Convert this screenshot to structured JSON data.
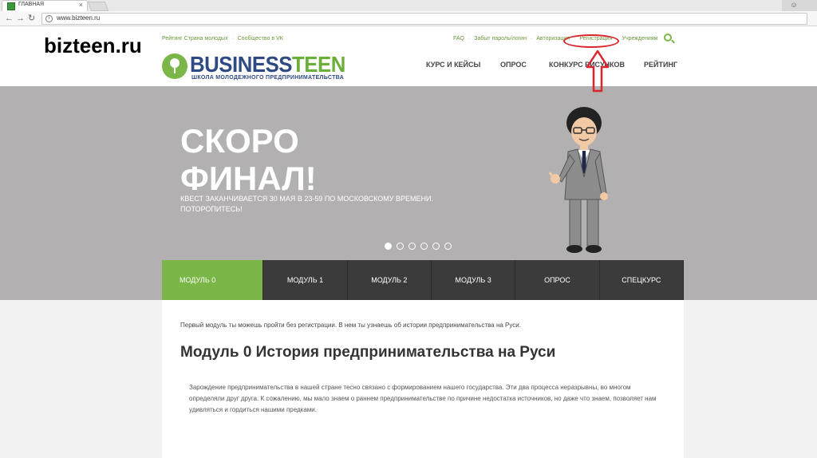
{
  "browser": {
    "tab_title": "ГЛАВНАЯ",
    "tab_close": "×",
    "url": "www.bizteen.ru"
  },
  "watermark": "bizteen.ru",
  "header": {
    "top_left_links": [
      "Рейтинг Страна молодых",
      "Сообщество в VK"
    ],
    "top_right_links": [
      "FAQ",
      "Забыт пароль/логин",
      "Авторизация",
      "Регистрация",
      "Учреждениям"
    ],
    "separator": "·",
    "logo_main": "BUSINESS",
    "logo_accent": "TEEN",
    "logo_subtitle": "ШКОЛА МОЛОДЕЖНОГО ПРЕДПРИНИМАТЕЛЬСТВА",
    "nav": [
      "КУРС И КЕЙСЫ",
      "ОПРОС",
      "КОНКУРС РИСУНКОВ",
      "РЕЙТИНГ"
    ]
  },
  "hero": {
    "title_line1": "СКОРО",
    "title_line2": "ФИНАЛ!",
    "subtitle": "КВЕСТ ЗАКАНЧИВАЕТСЯ 30 МАЯ В 23-59 ПО МОСКОВСКОМУ ВРЕМЕНИ. ПОТОРОПИТЕСЬ!",
    "slide_count": 6,
    "active_slide": 1
  },
  "modules": {
    "tabs": [
      "МОДУЛЬ 0",
      "МОДУЛЬ 1",
      "МОДУЛЬ 2",
      "МОДУЛЬ 3",
      "ОПРОС",
      "СПЕЦКУРС"
    ],
    "active": "МОДУЛЬ 0"
  },
  "content": {
    "intro": "Первый модуль ты можешь пройти без регистрации. В нем ты узнаешь об истории предпринимательства на Руси.",
    "heading": "Модуль 0 История предпринимательства на Руси",
    "paragraph": "Зарождение предпринимательства в нашей стране тесно связано с формированием нашего государства. Эти два процесса неразрывны, во многом определяли друг друга. К сожалению, мы мало знаем о раннем предпринимательстве по причине недостатка источников, но даже что знаем, позволяет нам удивляться и гордиться нашими предками."
  },
  "colors": {
    "accent_green": "#7ab648",
    "logo_blue": "#2e4a84",
    "hero_grey": "#b2b0b0",
    "tab_dark": "#3b3b3b",
    "annotation_red": "#d9262e"
  }
}
